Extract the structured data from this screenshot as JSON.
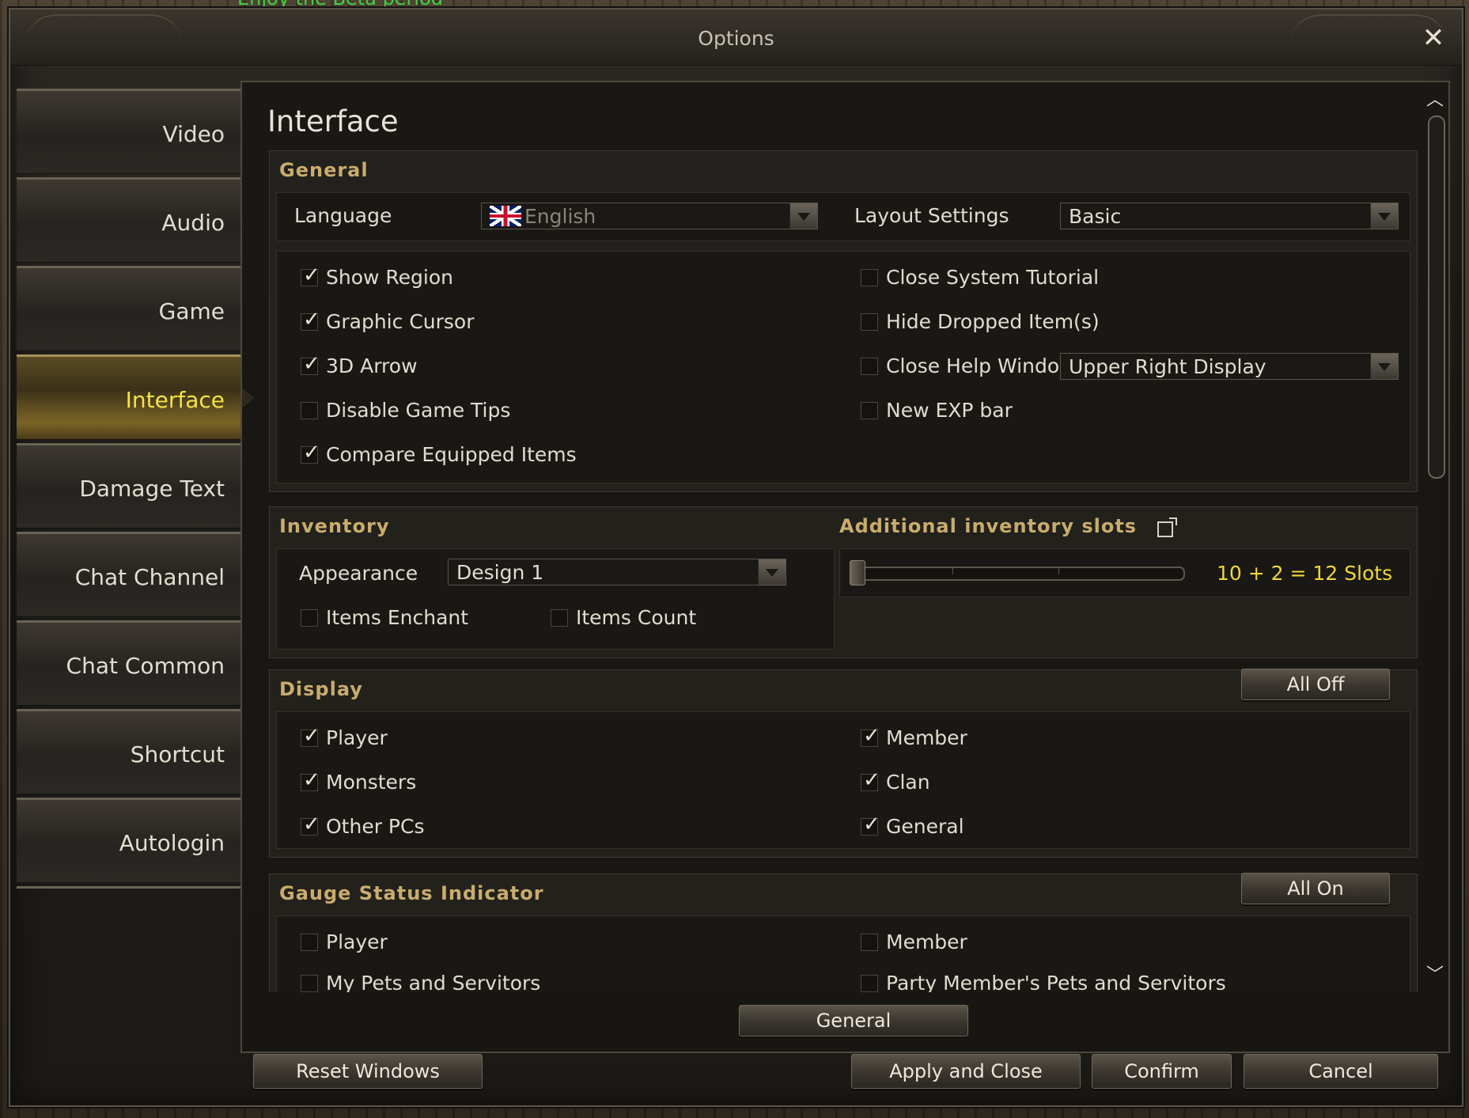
{
  "background_text": "Enjoy the Beta period",
  "window": {
    "title": "Options"
  },
  "sidebar": {
    "items": [
      {
        "label": "Video"
      },
      {
        "label": "Audio"
      },
      {
        "label": "Game"
      },
      {
        "label": "Interface",
        "active": true
      },
      {
        "label": "Damage Text"
      },
      {
        "label": "Chat Channel"
      },
      {
        "label": "Chat Common"
      },
      {
        "label": "Shortcut"
      },
      {
        "label": "Autologin"
      }
    ]
  },
  "main": {
    "title": "Interface",
    "general": {
      "title": "General",
      "language_label": "Language",
      "language_value": "English",
      "layout_label": "Layout Settings",
      "layout_value": "Basic",
      "options_left": [
        {
          "label": "Show Region",
          "checked": true
        },
        {
          "label": "Graphic Cursor",
          "checked": true
        },
        {
          "label": "3D Arrow",
          "checked": true
        },
        {
          "label": "Disable Game Tips",
          "checked": false
        },
        {
          "label": "Compare Equipped Items",
          "checked": true
        }
      ],
      "options_right": [
        {
          "label": "Close System Tutorial",
          "checked": false
        },
        {
          "label": "Hide Dropped Item(s)",
          "checked": false
        },
        {
          "label": "Close Help Window",
          "checked": false
        },
        {
          "label": "New EXP bar",
          "checked": false
        }
      ],
      "help_window_value": "Upper Right Display"
    },
    "inventory": {
      "title": "Inventory",
      "appearance_label": "Appearance",
      "appearance_value": "Design 1",
      "items_enchant": {
        "label": "Items Enchant",
        "checked": false
      },
      "items_count": {
        "label": "Items Count",
        "checked": false
      },
      "additional_title": "Additional inventory slots",
      "slots_text": "10 + 2 = 12 Slots",
      "slider_level": 0
    },
    "display": {
      "title": "Display",
      "button": "All Off",
      "left": [
        {
          "label": "Player",
          "checked": true
        },
        {
          "label": "Monsters",
          "checked": true
        },
        {
          "label": "Other PCs",
          "checked": true
        }
      ],
      "right": [
        {
          "label": "Member",
          "checked": true
        },
        {
          "label": "Clan",
          "checked": true
        },
        {
          "label": "General",
          "checked": true
        }
      ]
    },
    "gauge": {
      "title": "Gauge Status Indicator",
      "button": "All On",
      "left": [
        {
          "label": "Player",
          "checked": false
        },
        {
          "label": "My Pets and Servitors",
          "checked": false
        }
      ],
      "right": [
        {
          "label": "Member",
          "checked": false
        },
        {
          "label": "Party Member's Pets and Servitors",
          "checked": false
        }
      ]
    },
    "footer_button": "General"
  },
  "bottom": {
    "reset": "Reset Windows",
    "apply_close": "Apply and Close",
    "confirm": "Confirm",
    "cancel": "Cancel"
  },
  "colors": {
    "accent_gold": "#c9ac6d",
    "active_tab_text": "#f4e14a",
    "slots_text": "#f0d63e"
  }
}
